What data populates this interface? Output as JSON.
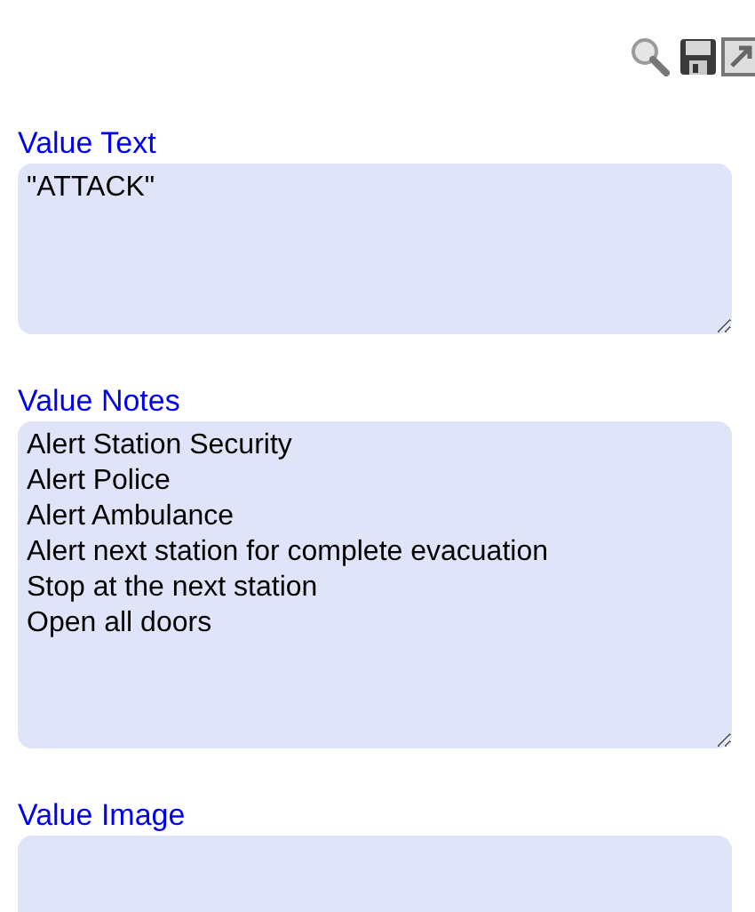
{
  "fields": [
    {
      "label": "Value Text",
      "value": "\"ATTACK\"",
      "kind": "short"
    },
    {
      "label": "Value Notes",
      "value": "Alert Station Security\nAlert Police\nAlert Ambulance\nAlert next station for complete evacuation\nStop at the next station\nOpen all doors",
      "kind": "tall"
    },
    {
      "label": "Value Image",
      "kind": "short"
    }
  ]
}
